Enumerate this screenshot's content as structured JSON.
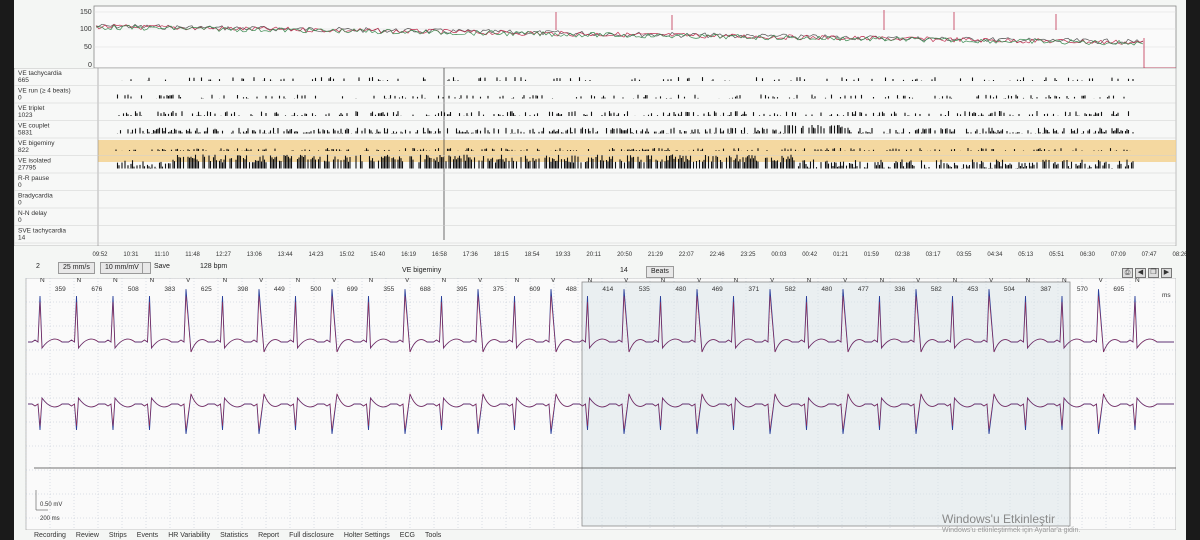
{
  "trend": {
    "y_ticks": [
      "150",
      "100",
      "50",
      "0"
    ]
  },
  "event_rows": [
    {
      "label": "VE tachycardia",
      "count": "665"
    },
    {
      "label": "VE run (≥ 4 beats)",
      "count": "0"
    },
    {
      "label": "VE triplet",
      "count": "1023"
    },
    {
      "label": "VE couplet",
      "count": "5831"
    },
    {
      "label": "VE bigeminy",
      "count": "822"
    },
    {
      "label": "VE isolated",
      "count": "27795"
    },
    {
      "label": "R-R pause",
      "count": "0"
    },
    {
      "label": "Bradycardia",
      "count": "0"
    },
    {
      "label": "N-N delay",
      "count": "0"
    },
    {
      "label": "SVE tachycardia",
      "count": "14"
    }
  ],
  "time_axis": [
    "09:52",
    "10:31",
    "11:10",
    "11:48",
    "12:27",
    "13:06",
    "13:44",
    "14:23",
    "15:02",
    "15:40",
    "16:19",
    "16:58",
    "17:36",
    "18:15",
    "18:54",
    "19:33",
    "20:11",
    "20:50",
    "21:29",
    "22:07",
    "22:46",
    "23:25",
    "00:03",
    "00:42",
    "01:21",
    "01:59",
    "02:38",
    "03:17",
    "03:55",
    "04:34",
    "05:13",
    "05:51",
    "06:30",
    "07:09",
    "07:47",
    "08:26"
  ],
  "controls": {
    "lead": "2",
    "speed": "25 mm/s",
    "gain": "10 mm/mV",
    "save": "Save",
    "bpm": "128 bpm",
    "event_name": "VE bigeminy",
    "beats_count": "14",
    "beats_btn": "Beats"
  },
  "beat_labels": [
    "N",
    "N",
    "N",
    "N",
    "V",
    "N",
    "V",
    "N",
    "V",
    "N",
    "V",
    "N",
    "V",
    "N",
    "V",
    "N",
    "V",
    "N",
    "V",
    "N",
    "V",
    "N",
    "V",
    "N",
    "V",
    "N",
    "V",
    "N",
    "N",
    "V",
    "N"
  ],
  "rr_intervals": [
    "359",
    "676",
    "508",
    "383",
    "625",
    "398",
    "449",
    "500",
    "699",
    "355",
    "688",
    "395",
    "375",
    "609",
    "488",
    "414",
    "535",
    "480",
    "469",
    "371",
    "582",
    "480",
    "477",
    "336",
    "582",
    "453",
    "504",
    "387",
    "570",
    "695"
  ],
  "scale": {
    "mv": "0.50 mV",
    "ms": "200 ms"
  },
  "rr_unit": "ms",
  "bottom_tabs": [
    "Recording",
    "Review",
    "Strips",
    "Events",
    "HR Variability",
    "Statistics",
    "Report",
    "Full disclosure",
    "Holter Settings",
    "ECG",
    "Tools"
  ],
  "watermark": "Windows'u Etkinleştir",
  "watermark_sub": "Windows'u etkinleştirmek için Ayarlar'a gidin."
}
